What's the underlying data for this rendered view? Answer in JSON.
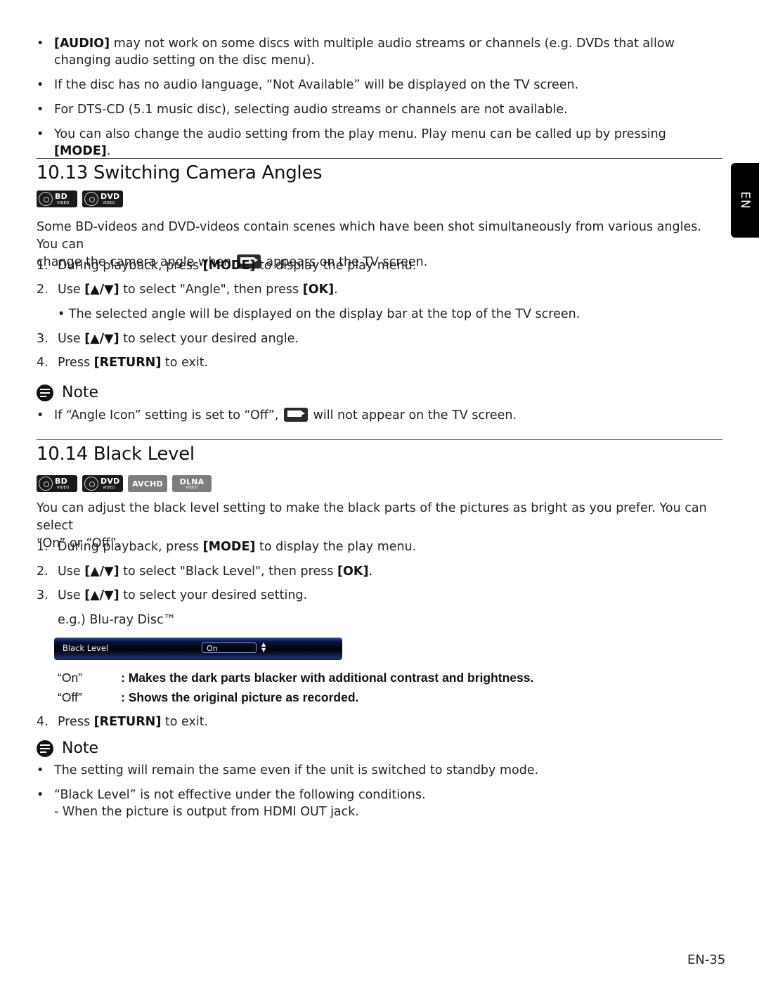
{
  "intro_bullets": [
    {
      "key": "[AUDIO]",
      "text": " may not work on some discs with multiple audio streams or channels (e.g. DVDs that allow changing audio setting on the disc menu)."
    },
    {
      "text": "If the disc has no audio language, “Not Available” will be displayed on the TV screen."
    },
    {
      "text": "For DTS-CD (5.1 music disc), selecting audio streams or channels are not available."
    },
    {
      "text": "You can also change the audio setting from the play menu. Play menu can be called up by pressing ",
      "key": "[MODE]",
      "after": "."
    }
  ],
  "section_1": {
    "title": "10.13 Switching Camera Angles",
    "badges": [
      {
        "main": "BD",
        "sub": "VIDEO",
        "icon": "disc-icon"
      },
      {
        "main": "DVD",
        "sub": "VIDEO",
        "icon": "disc-icon"
      }
    ],
    "intro_line1": "Some BD-videos and DVD-videos contain scenes which have been shot simultaneously from various angles. You can",
    "intro_line2_a": "change the camera angle when",
    "intro_line2_b": "appears on the TV screen.",
    "steps": [
      {
        "num": "1.",
        "pre": "During playback, press ",
        "key": "[MODE]",
        "post": " to display the play menu."
      },
      {
        "num": "2.",
        "pre": "Use ",
        "key": "[▲/▼]",
        "post": " to select \"Angle\", then press ",
        "key2": "[OK]",
        "post2": "."
      },
      {
        "num": "3.",
        "pre": "Use ",
        "key": "[▲/▼]",
        "post": " to select your desired angle."
      },
      {
        "num": "4.",
        "pre": "Press ",
        "key": "[RETURN]",
        "post": " to exit."
      }
    ],
    "sub_bullet": "The selected angle will be displayed on the display bar at the top of the TV screen.",
    "note_title": "Note",
    "note_a": "If “Angle Icon” setting is set to “Off”,",
    "note_b": "will not appear on the TV screen."
  },
  "section_2": {
    "title": "10.14 Black Level",
    "badges": [
      {
        "main": "BD",
        "sub": "VIDEO",
        "icon": "disc-icon"
      },
      {
        "main": "DVD",
        "sub": "VIDEO",
        "icon": "disc-icon"
      },
      {
        "main": "AVCHD",
        "sub": ""
      },
      {
        "main": "DLNA",
        "sub": "VIDEO"
      }
    ],
    "intro_line1": "You can adjust the black level setting to make the black parts of the pictures as bright as you prefer. You can select",
    "intro_line2": "“On” or “Off”.",
    "steps": [
      {
        "num": "1.",
        "pre": "During playback, press ",
        "key": "[MODE]",
        "post": " to display the play menu."
      },
      {
        "num": "2.",
        "pre": "Use ",
        "key": "[▲/▼]",
        "post": " to select \"Black Level\", then press ",
        "key2": "[OK]",
        "post2": "."
      },
      {
        "num": "3.",
        "pre": "Use ",
        "key": "[▲/▼]",
        "post": " to select your desired setting."
      },
      {
        "num": "4.",
        "pre": "Press ",
        "key": "[RETURN]",
        "post": " to exit."
      }
    ],
    "example_label": "e.g.) Blu-ray Disc™",
    "osd": {
      "label": "Black Level",
      "value": "On"
    },
    "definitions": [
      {
        "term": "“On”",
        "desc": ": Makes the dark parts blacker with additional contrast and brightness."
      },
      {
        "term": "“Off”",
        "desc": ": Shows the original picture as recorded."
      }
    ],
    "note_title": "Note",
    "notes": [
      "The setting will remain the same even if the unit is switched to standby mode.",
      "“Black Level” is not effective under the following conditions."
    ],
    "note_sub": "- When the picture is output from HDMI OUT jack."
  },
  "lang_tab": "EN",
  "page_number": "EN-35"
}
